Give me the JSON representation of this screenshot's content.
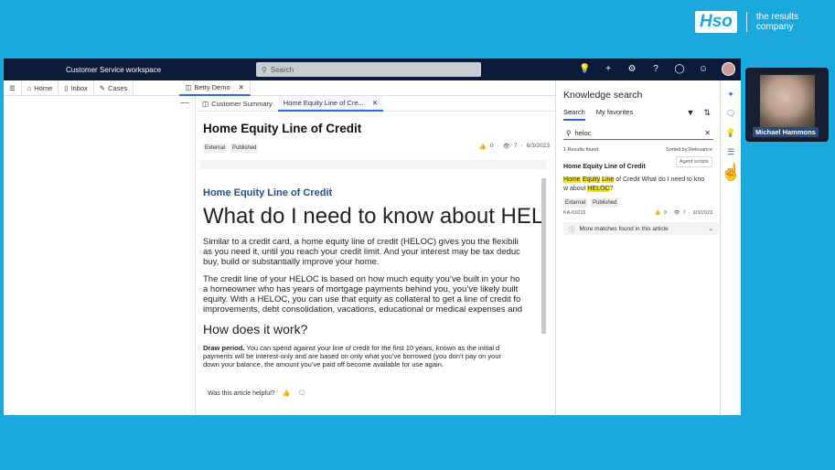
{
  "brand": {
    "logo": "Hso",
    "tagline": "the results company"
  },
  "app": {
    "title": "Customer Service workspace",
    "search_placeholder": "Search"
  },
  "tabs": {
    "home": "Home",
    "inbox": "Inbox",
    "cases": "Cases",
    "session": "Betty Demo"
  },
  "subtabs": {
    "summary": "Customer Summary",
    "article": "Home Equity Line of Cre..."
  },
  "article": {
    "title": "Home Equity Line of Credit",
    "tags": [
      "External",
      "Published"
    ],
    "likes": "0",
    "views": "7",
    "date": "6/3/2023",
    "heading_link": "Home Equity Line of Credit",
    "big_heading": "What do I need to know about HELOC",
    "para1": [
      "Similar to a credit card, a home equity line of credit (HELOC) gives you the flexibili",
      "as you need it, until you reach your credit limit. And your interest may be tax deduc",
      "buy, build or substantially improve your home."
    ],
    "para2": [
      "The credit line of your HELOC is based on how much equity you’ve built in your ho",
      "a homeowner who has years of mortgage payments behind you, you’ve likely built",
      "equity. With a HELOC, you can use that equity as collateral to get a line of credit fo",
      "improvements, debt consolidation, vacations, educational or medical expenses and"
    ],
    "h2": "How does it work?",
    "para3_bold": "Draw period.",
    "para3": [
      " You can spend against your line of credit for the first 10 years, known as the initial d",
      "payments will be interest-only and are based on only what you’ve borrowed (you don’t pay on your",
      "down your balance, the amount you’ve paid off become available for use again."
    ],
    "helpful": "Was this article helpful?"
  },
  "knowledge": {
    "title": "Knowledge search",
    "tab_search": "Search",
    "tab_favorites": "My favorites",
    "query": "heloc",
    "found": "1 Results found",
    "sorted": "Sorted by Relevance",
    "tooltip": "Agent scripts",
    "result_title": "Home Equity Line of Credit",
    "result_hl1": "Home",
    "result_hl2": "Equity",
    "result_hl3": "Line",
    "result_text1": " of Credit What do I need to kno",
    "result_text2": "w about ",
    "result_hl4": "HELOC",
    "result_text3": "?",
    "result_tags": [
      "External",
      "Published"
    ],
    "result_id": "KA-01015",
    "result_likes": "0",
    "result_views": "7",
    "result_date": "6/3/2023",
    "more": "More matches found in this article"
  },
  "participant": {
    "name": "Michael Hammons"
  }
}
